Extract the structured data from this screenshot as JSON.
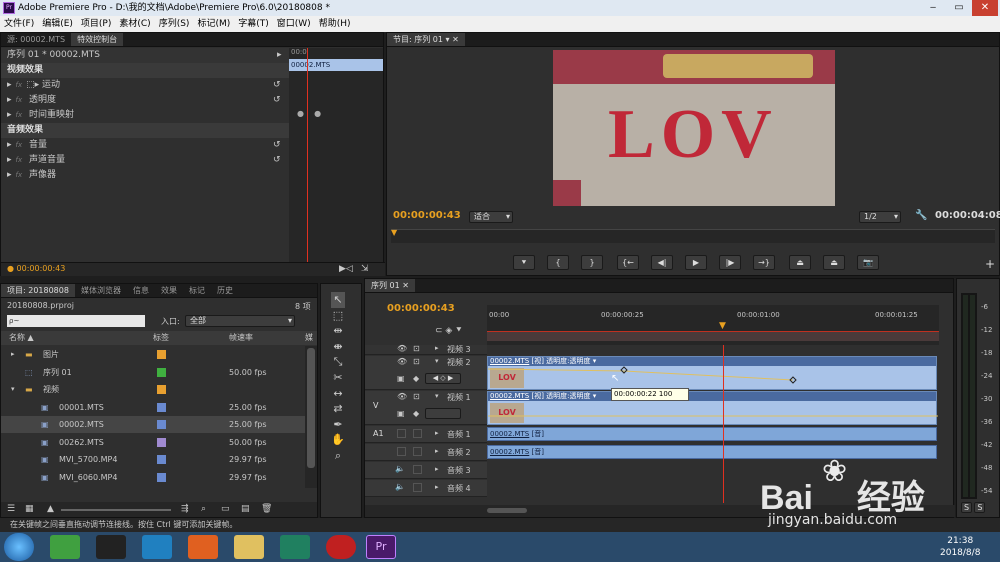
{
  "window": {
    "title": "Adobe Premiere Pro - D:\\我的文档\\Adobe\\Premiere Pro\\6.0\\20180808 *",
    "app_icon": "Pr"
  },
  "menu": [
    "文件(F)",
    "编辑(E)",
    "项目(P)",
    "素材(C)",
    "序列(S)",
    "标记(M)",
    "字幕(T)",
    "窗口(W)",
    "帮助(H)"
  ],
  "effects_panel": {
    "tabs": [
      "源: 00002.MTS",
      "特效控制台"
    ],
    "sequence_label": "序列 01 * 00002.MTS",
    "clip_label": "00002.MTS",
    "ruler_label": "00:0",
    "video_header": "视频效果",
    "video_effects": [
      "运动",
      "透明度",
      "时间重映射"
    ],
    "audio_header": "音频效果",
    "audio_effects": [
      "音量",
      "声道音量",
      "声像器"
    ],
    "timecode": "00:00:00:43"
  },
  "program": {
    "tab": "节目: 序列 01",
    "timecode": "00:00:00:43",
    "zoom": "适合",
    "quality": "1/2",
    "duration": "00:00:04:08",
    "frame_text": "LOV"
  },
  "project": {
    "tabs": [
      "项目: 20180808",
      "媒体浏览器",
      "信息",
      "效果",
      "标记",
      "历史"
    ],
    "file": "20180808.prproj",
    "count": "8 项",
    "search_placeholder": "ρ~",
    "in_label": "入口:",
    "in_value": "全部",
    "columns": [
      "名称",
      "标签",
      "帧速率",
      "媒"
    ],
    "items": [
      {
        "name": "图片",
        "fps": "",
        "color": "#e8a030",
        "type": "folder",
        "indent": 1
      },
      {
        "name": "序列 01",
        "fps": "50.00 fps",
        "color": "#40b040",
        "type": "sequence",
        "indent": 1
      },
      {
        "name": "视频",
        "fps": "",
        "color": "#e8a030",
        "type": "folder",
        "indent": 1
      },
      {
        "name": "00001.MTS",
        "fps": "25.00 fps",
        "color": "#6a8ad0",
        "type": "clip",
        "indent": 2
      },
      {
        "name": "00002.MTS",
        "fps": "25.00 fps",
        "color": "#6a8ad0",
        "type": "clip",
        "indent": 2
      },
      {
        "name": "00262.MTS",
        "fps": "50.00 fps",
        "color": "#a08ad0",
        "type": "clip",
        "indent": 2
      },
      {
        "name": "MVI_5700.MP4",
        "fps": "29.97 fps",
        "color": "#6a8ad0",
        "type": "clip",
        "indent": 2
      },
      {
        "name": "MVI_6060.MP4",
        "fps": "29.97 fps",
        "color": "#6a8ad0",
        "type": "clip",
        "indent": 2
      }
    ]
  },
  "timeline": {
    "tab": "序列 01",
    "timecode": "00:00:00:43",
    "ruler": [
      "00:00",
      "00:00:00:25",
      "00:00:01:00",
      "00:00:01:25"
    ],
    "tracks": [
      {
        "name": "视频 3",
        "kind": "video"
      },
      {
        "name": "视频 2",
        "kind": "video",
        "clip": "00002.MTS",
        "clip_info": "[视] 透明度:透明度 ▾"
      },
      {
        "name": "视频 1",
        "kind": "video",
        "target": "V",
        "clip": "00002.MTS",
        "clip_info": "[视] 透明度:透明度 ▾"
      },
      {
        "name": "音频 1",
        "kind": "audio",
        "target": "A1",
        "clip": "00002.MTS",
        "clip_info": "[音]"
      },
      {
        "name": "音频 2",
        "kind": "audio",
        "clip": "00002.MTS",
        "clip_info": "[音]"
      },
      {
        "name": "音频 3",
        "kind": "audio"
      },
      {
        "name": "音频 4",
        "kind": "audio"
      }
    ],
    "tooltip": "00:00:00:22  100"
  },
  "meter": {
    "labels": [
      "-6",
      "-12",
      "-18",
      "-24",
      "-30",
      "-36",
      "-42",
      "-48",
      "-54"
    ],
    "solo": [
      "S",
      "S"
    ]
  },
  "status_bar": "在关键帧之间垂直拖动调节连接线。按住 Ctrl 键可添加关键帧。",
  "taskbar": {
    "time": "21:38",
    "date": "2018/8/8"
  },
  "watermark": {
    "brand": "Bai",
    "brand2": "经验",
    "url": "jingyan.baidu.com"
  }
}
